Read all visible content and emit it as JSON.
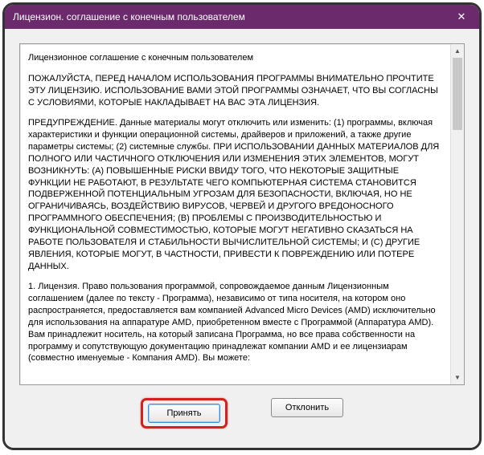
{
  "titlebar": {
    "title": "Лицензион. соглашение с конечным пользователем",
    "close_icon": "✕"
  },
  "eula": {
    "heading": "Лицензионное соглашение с конечным пользователем",
    "p1": "ПОЖАЛУЙСТА, ПЕРЕД НАЧАЛОМ ИСПОЛЬЗОВАНИЯ ПРОГРАММЫ ВНИМАТЕЛЬНО ПРОЧТИТЕ ЭТУ ЛИЦЕНЗИЮ. ИСПОЛЬЗОВАНИЕ ВАМИ ЭТОЙ ПРОГРАММЫ ОЗНАЧАЕТ, ЧТО ВЫ СОГЛАСНЫ С УСЛОВИЯМИ, КОТОРЫЕ НАКЛАДЫВАЕТ НА ВАС ЭТА ЛИЦЕНЗИЯ.",
    "p2": "ПРЕДУПРЕЖДЕНИЕ. Данные материалы могут отключить или изменить: (1) программы, включая характеристики и функции операционной системы, драйверов и приложений, а также другие параметры системы; (2) системные службы. ПРИ ИСПОЛЬЗОВАНИИ ДАННЫХ МАТЕРИАЛОВ ДЛЯ ПОЛНОГО ИЛИ ЧАСТИЧНОГО ОТКЛЮЧЕНИЯ ИЛИ ИЗМЕНЕНИЯ ЭТИХ ЭЛЕМЕНТОВ, МОГУТ ВОЗНИКНУТЬ: (А) ПОВЫШЕННЫЕ РИСКИ ВВИДУ ТОГО, ЧТО НЕКОТОРЫЕ ЗАЩИТНЫЕ ФУНКЦИИ НЕ РАБОТАЮТ, В РЕЗУЛЬТАТЕ ЧЕГО КОМПЬЮТЕРНАЯ СИСТЕМА СТАНОВИТСЯ ПОДВЕРЖЕННОЙ ПОТЕНЦИАЛЬНЫМ УГРОЗАМ ДЛЯ БЕЗОПАСНОСТИ, ВКЛЮЧАЯ, НО НЕ ОГРАНИЧИВАЯСЬ, ВОЗДЕЙСТВИЮ ВИРУСОВ, ЧЕРВЕЙ И ДРУГОГО ВРЕДОНОСНОГО ПРОГРАММНОГО ОБЕСПЕЧЕНИЯ; (В) ПРОБЛЕМЫ С ПРОИЗВОДИТЕЛЬНОСТЬЮ И ФУНКЦИОНАЛЬНОЙ СОВМЕСТИМОСТЬЮ, КОТОРЫЕ МОГУТ НЕГАТИВНО СКАЗАТЬСЯ НА РАБОТЕ ПОЛЬЗОВАТЕЛЯ И СТАБИЛЬНОСТИ ВЫЧИСЛИТЕЛЬНОЙ СИСТЕМЫ; И (С) ДРУГИЕ ЯВЛЕНИЯ, КОТОРЫЕ МОГУТ, В ЧАСТНОСТИ, ПРИВЕСТИ К ПОВРЕЖДЕНИЮ ИЛИ ПОТЕРЕ ДАННЫХ.",
    "p3": "1. Лицензия. Право пользования программой, сопровождаемое данным Лицензионным соглашением (далее по тексту - Программа), независимо от типа носителя, на котором оно распространяется, предоставляется вам компанией Advanced Micro Devices (AMD) исключительно для использования на аппаратуре AMD, приобретенном вместе с Программой (Аппаратура AMD). Вам принадлежит носитель, на который записана Программа, но все права собственности на программу и сопутствующую документацию принадлежат компании AMD и ее лицензиарам (совместно именуемые - Компания AMD). Вы можете:"
  },
  "scrollbar": {
    "up": "▲",
    "down": "▼"
  },
  "buttons": {
    "accept": "Принять",
    "decline": "Отклонить"
  }
}
